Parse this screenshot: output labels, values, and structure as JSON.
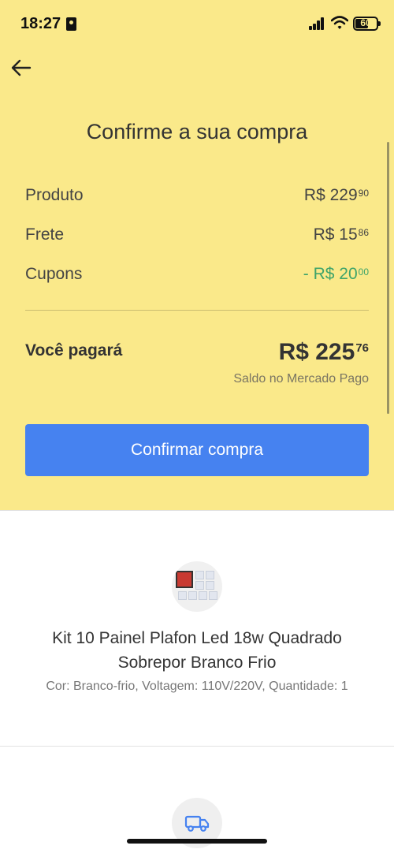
{
  "status": {
    "time": "18:27",
    "battery": "60",
    "battery_fraction": 0.6
  },
  "header": {
    "title": "Confirme a sua compra"
  },
  "summary": {
    "rows": [
      {
        "label": "Produto",
        "amount_main": "R$ 229",
        "amount_cents": "90"
      },
      {
        "label": "Frete",
        "amount_main": "R$ 15",
        "amount_cents": "86"
      },
      {
        "label": "Cupons",
        "amount_main": "- R$ 20",
        "amount_cents": "00",
        "color": "#3fa46a"
      }
    ],
    "total_label": "Você pagará",
    "total_main": "R$ 225",
    "total_cents": "76",
    "payment_method": "Saldo no Mercado Pago"
  },
  "confirm_button": {
    "label": "Confirmar compra",
    "color": "#4682f0"
  },
  "product": {
    "name": "Kit 10 Painel Plafon Led 18w Quadrado Sobrepor Branco Frio",
    "attributes": "Cor: Branco-frio, Voltagem: 110V/220V, Quantidade: 1"
  },
  "colors": {
    "header_background": "#fae98a",
    "accent": "#4682f0"
  },
  "icons": {
    "back": "arrow-left-icon",
    "shipping": "truck-icon"
  }
}
